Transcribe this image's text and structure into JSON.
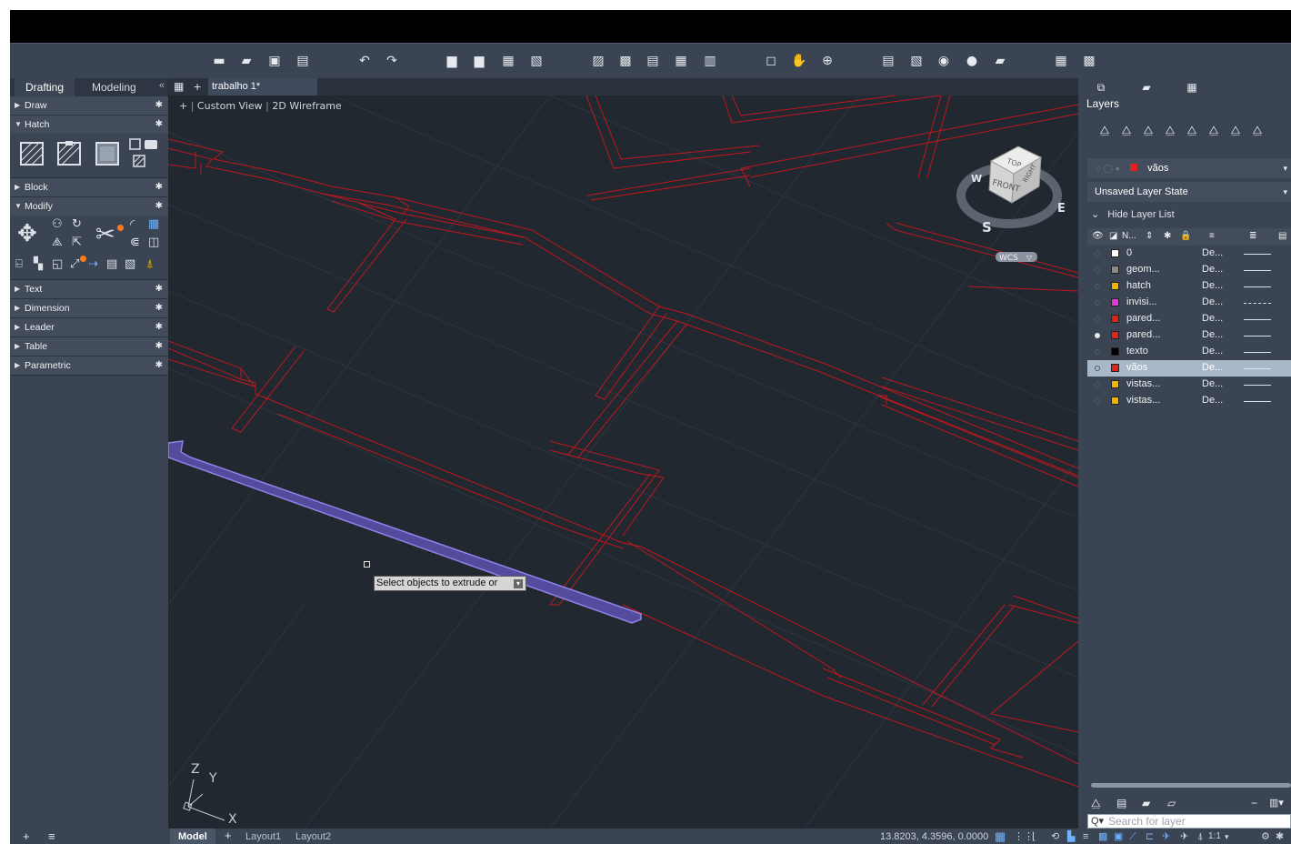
{
  "toolbar": {
    "icons": [
      "new-icon",
      "open-icon",
      "save-icon",
      "save-as-icon",
      "undo-icon",
      "redo-icon",
      "plot-icon",
      "batch-plot-icon",
      "publish-icon",
      "export-pdf-icon",
      "import-icon",
      "attach-icon",
      "xref-icon",
      "insert-block-icon",
      "matchprop-icon",
      "zoom-window-icon",
      "pan-icon",
      "orbit-icon",
      "properties-icon",
      "layer-properties-icon",
      "quickcalc-icon",
      "design-center-icon",
      "sheet-set-icon",
      "tool-palette-icon",
      "markup-icon"
    ]
  },
  "palette": {
    "tabs": [
      "Drafting",
      "Modeling"
    ],
    "active_tab": "Drafting",
    "collapse": "«",
    "sections": [
      {
        "label": "Draw",
        "expanded": false
      },
      {
        "label": "Hatch",
        "expanded": true
      },
      {
        "label": "Block",
        "expanded": false
      },
      {
        "label": "Modify",
        "expanded": true
      },
      {
        "label": "Text",
        "expanded": false
      },
      {
        "label": "Dimension",
        "expanded": false
      },
      {
        "label": "Leader",
        "expanded": false
      },
      {
        "label": "Table",
        "expanded": false
      },
      {
        "label": "Parametric",
        "expanded": false
      }
    ]
  },
  "document": {
    "file_tab": "trabalho 1*",
    "add_tab": "+",
    "view_plus": "+",
    "view_name": "Custom View",
    "visual_style": "2D Wireframe",
    "viewcube": {
      "top": "TOP",
      "front": "FRONT",
      "right": "RIGHT",
      "n": "W",
      "s": "S",
      "e": "E",
      "wcs": "WCS"
    },
    "ucs": {
      "z": "Z",
      "y": "Y",
      "x": "X"
    },
    "tooltip": "Select objects to extrude or"
  },
  "status": {
    "left_plus": "+",
    "left_menu": "≡",
    "tabs": [
      "Model",
      "Layout1",
      "Layout2"
    ],
    "add_layout": "+",
    "coords": "13.8203, 4.3596, 0.0000",
    "scale": "1:1"
  },
  "layers": {
    "title": "Layers",
    "current_layer": "vãos",
    "layer_state": "Unsaved Layer State",
    "hide_list": "Hide Layer List",
    "header_name": "N...",
    "search_placeholder": "Search for layer",
    "rows": [
      {
        "name": "0",
        "lt": "De...",
        "color": "#ffffff",
        "current": false,
        "dashed": false
      },
      {
        "name": "geom...",
        "lt": "De...",
        "color": "#8a8a8a",
        "current": false,
        "dashed": false
      },
      {
        "name": "hatch",
        "lt": "De...",
        "color": "#f0b400",
        "current": false,
        "dashed": false
      },
      {
        "name": "invisi...",
        "lt": "De...",
        "color": "#e03ad8",
        "current": false,
        "dashed": true
      },
      {
        "name": "pared...",
        "lt": "De...",
        "color": "#e0221c",
        "current": false,
        "dashed": false
      },
      {
        "name": "pared...",
        "lt": "De...",
        "color": "#e0221c",
        "current": true,
        "dashed": false
      },
      {
        "name": "texto",
        "lt": "De...",
        "color": "#000000",
        "current": false,
        "dashed": false
      },
      {
        "name": "vãos",
        "lt": "De...",
        "color": "#e0221c",
        "current": false,
        "dashed": false,
        "selected": true
      },
      {
        "name": "vistas...",
        "lt": "De...",
        "color": "#f0b400",
        "current": false,
        "dashed": false
      },
      {
        "name": "vistas...",
        "lt": "De...",
        "color": "#f0b400",
        "current": false,
        "dashed": false
      }
    ]
  }
}
